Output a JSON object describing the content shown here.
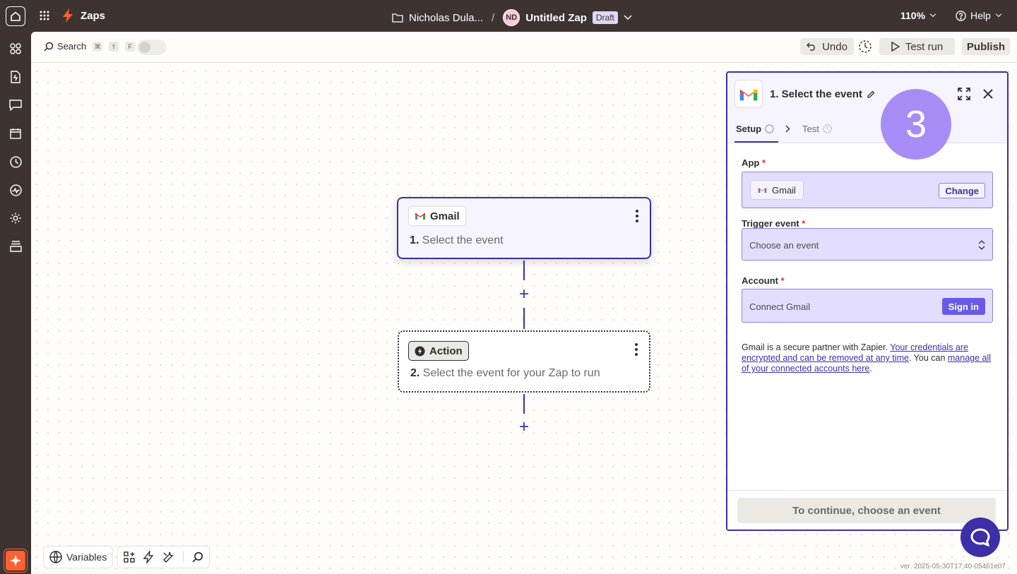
{
  "topbar": {
    "app_name": "Zaps",
    "folder": "Nicholas Dula...",
    "separator": "/",
    "avatar_initials": "ND",
    "zap_title": "Untitled Zap",
    "status_badge": "Draft",
    "zoom": "110%",
    "help": "Help"
  },
  "toolbar": {
    "search_label": "Search",
    "shortcut_keys": [
      "⌘",
      "⇧",
      "F"
    ],
    "undo": "Undo",
    "test_run": "Test run",
    "publish": "Publish"
  },
  "nodes": [
    {
      "app": "Gmail",
      "step_number": "1.",
      "text": "Select the event"
    },
    {
      "app": "Action",
      "step_number": "2.",
      "text": "Select the event for your Zap to run"
    }
  ],
  "panel": {
    "title": "1. Select the event",
    "tabs": [
      {
        "label": "Setup"
      },
      {
        "label": "Test"
      }
    ],
    "app_label": "App",
    "app_value": "Gmail",
    "change_button": "Change",
    "trigger_label": "Trigger event",
    "trigger_placeholder": "Choose an event",
    "account_label": "Account",
    "account_placeholder": "Connect Gmail",
    "signin_button": "Sign in",
    "note_prefix": "Gmail is a secure partner with Zapier. ",
    "note_link1": "Your credentials are encrypted and can be removed at any time",
    "note_mid": ". You can ",
    "note_link2": "manage all of your connected accounts here",
    "note_suffix": ".",
    "continue_button": "To continue, choose an event",
    "required_marker": "*"
  },
  "step_indicator": "3",
  "bottombar": {
    "variables": "Variables"
  },
  "version": "ver. 2025-05-30T17:40-05461e07",
  "colors": {
    "chrome": "#3d3431",
    "accent": "#3d2fa8",
    "accent_light": "#e3deff",
    "brand_orange": "#ff6131",
    "step_circle": "#a88cf6"
  }
}
